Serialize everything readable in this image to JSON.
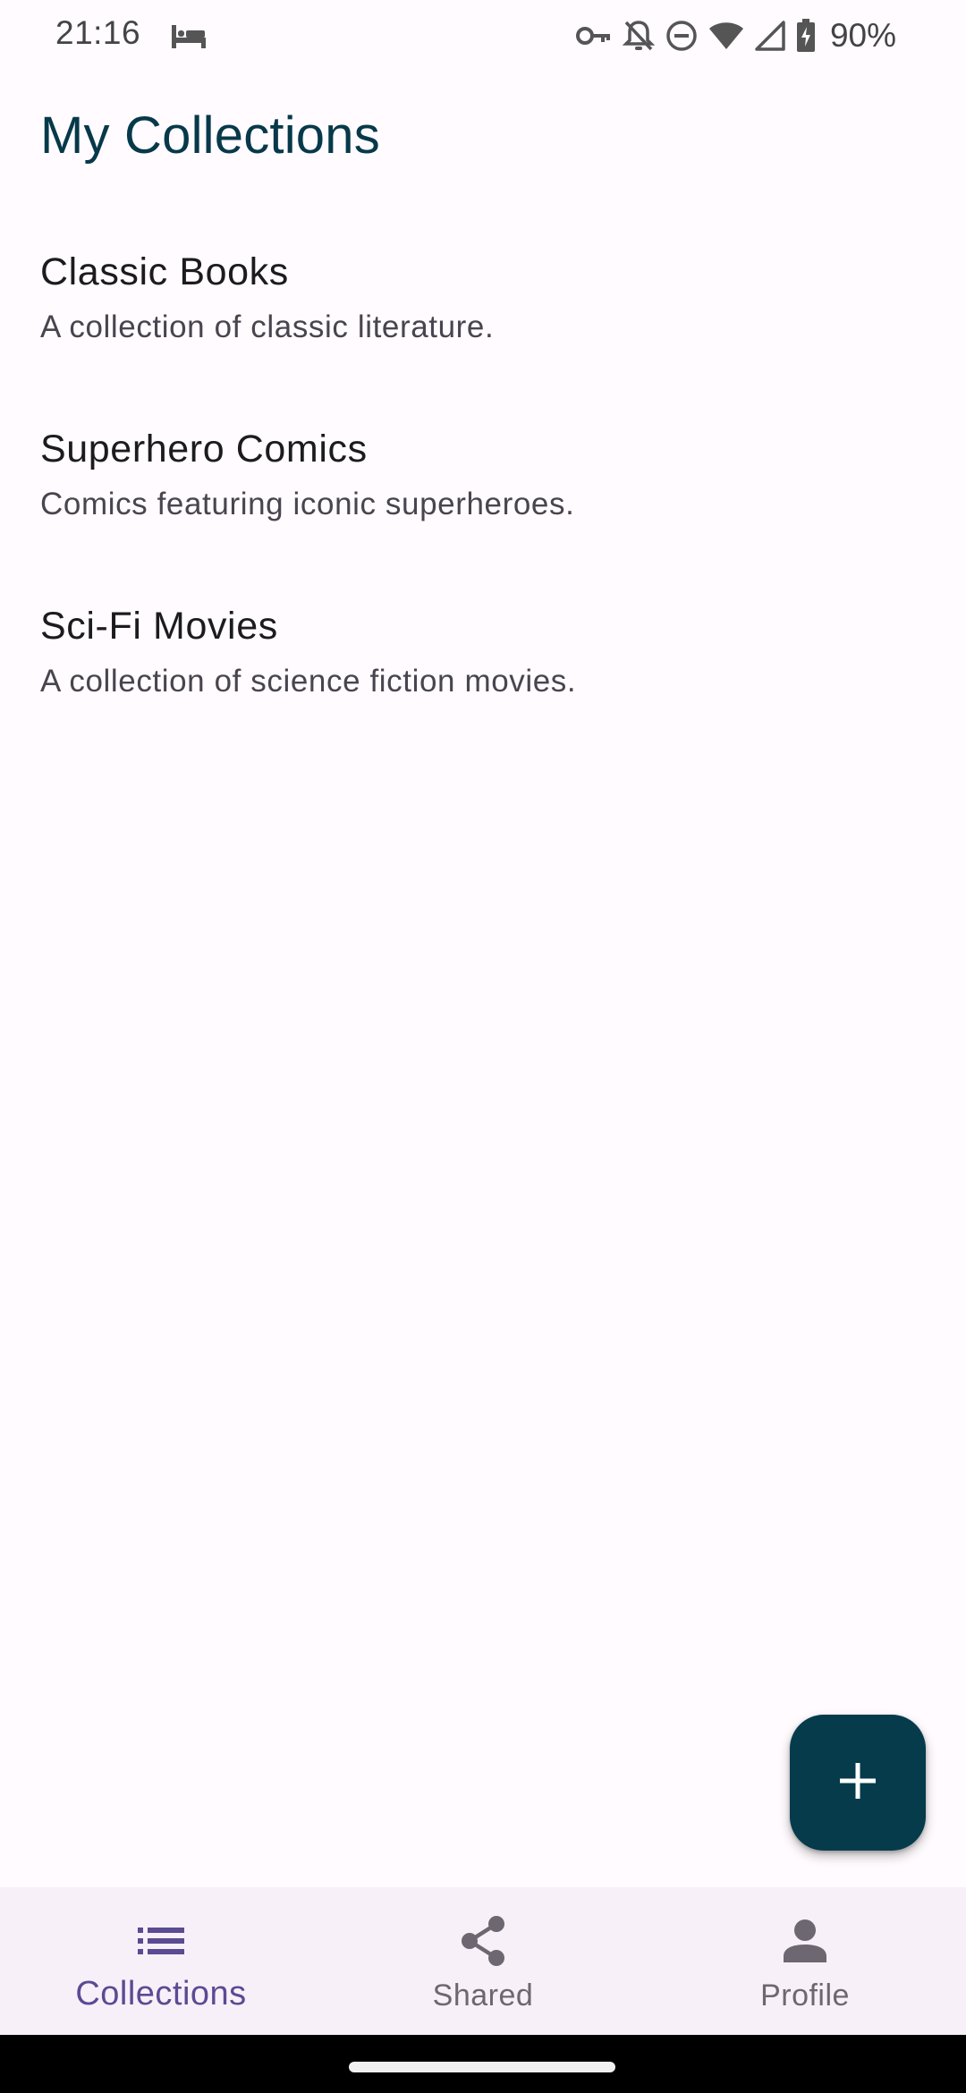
{
  "status_bar": {
    "time": "21:16",
    "battery": "90%",
    "icons": [
      "sleep-icon",
      "vpn-key-icon",
      "notifications-off-icon",
      "do-not-disturb-icon",
      "wifi-icon",
      "cell-signal-icon",
      "battery-charging-icon"
    ]
  },
  "page": {
    "title": "My Collections"
  },
  "collections": [
    {
      "title": "Classic Books",
      "description": "A collection of classic literature."
    },
    {
      "title": "Superhero Comics",
      "description": "Comics featuring iconic superheroes."
    },
    {
      "title": "Sci-Fi Movies",
      "description": "A collection of science fiction movies."
    }
  ],
  "fab": {
    "icon": "add-icon"
  },
  "bottom_nav": {
    "items": [
      {
        "label": "Collections",
        "icon": "list-icon",
        "active": true
      },
      {
        "label": "Shared",
        "icon": "share-icon",
        "active": false
      },
      {
        "label": "Profile",
        "icon": "person-icon",
        "active": false
      }
    ]
  },
  "colors": {
    "primary": "#06394a",
    "fab": "#063b4c",
    "nav_active": "#5a4b93",
    "nav_bg": "#f7f0f8"
  }
}
